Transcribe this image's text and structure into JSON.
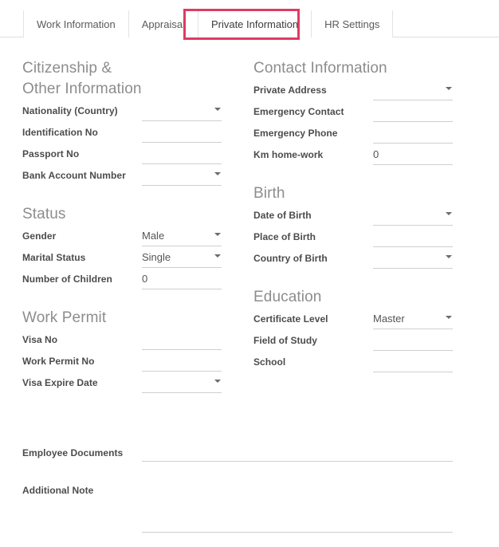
{
  "tabs": [
    {
      "label": "Work Information",
      "active": false
    },
    {
      "label": "Appraisal",
      "active": false
    },
    {
      "label": "Private Information",
      "active": true
    },
    {
      "label": "HR Settings",
      "active": false
    }
  ],
  "highlight_color": "#de3b63",
  "groups": {
    "citizenship": {
      "title": "Citizenship & Other Information",
      "fields": [
        {
          "label": "Nationality (Country)",
          "value": "",
          "type": "select"
        },
        {
          "label": "Identification No",
          "value": "",
          "type": "text"
        },
        {
          "label": "Passport No",
          "value": "",
          "type": "text"
        },
        {
          "label": "Bank Account Number",
          "value": "",
          "type": "select"
        }
      ]
    },
    "contact": {
      "title": "Contact Information",
      "fields": [
        {
          "label": "Private Address",
          "value": "",
          "type": "select"
        },
        {
          "label": "Emergency Contact",
          "value": "",
          "type": "text"
        },
        {
          "label": "Emergency Phone",
          "value": "",
          "type": "text"
        },
        {
          "label": "Km home-work",
          "value": "0",
          "type": "text"
        }
      ]
    },
    "status": {
      "title": "Status",
      "fields": [
        {
          "label": "Gender",
          "value": "Male",
          "type": "select"
        },
        {
          "label": "Marital Status",
          "value": "Single",
          "type": "select"
        },
        {
          "label": "Number of Children",
          "value": "0",
          "type": "text"
        }
      ]
    },
    "birth": {
      "title": "Birth",
      "fields": [
        {
          "label": "Date of Birth",
          "value": "",
          "type": "select"
        },
        {
          "label": "Place of Birth",
          "value": "",
          "type": "text"
        },
        {
          "label": "Country of Birth",
          "value": "",
          "type": "select"
        }
      ]
    },
    "work_permit": {
      "title": "Work Permit",
      "fields": [
        {
          "label": "Visa No",
          "value": "",
          "type": "text"
        },
        {
          "label": "Work Permit No",
          "value": "",
          "type": "text"
        },
        {
          "label": "Visa Expire Date",
          "value": "",
          "type": "select"
        }
      ]
    },
    "education": {
      "title": "Education",
      "fields": [
        {
          "label": "Certificate Level",
          "value": "Master",
          "type": "select"
        },
        {
          "label": "Field of Study",
          "value": "",
          "type": "text"
        },
        {
          "label": "School",
          "value": "",
          "type": "text"
        }
      ]
    }
  },
  "wide_fields": [
    {
      "label": "Employee Documents",
      "value": ""
    },
    {
      "label": "Additional Note",
      "value": ""
    }
  ]
}
